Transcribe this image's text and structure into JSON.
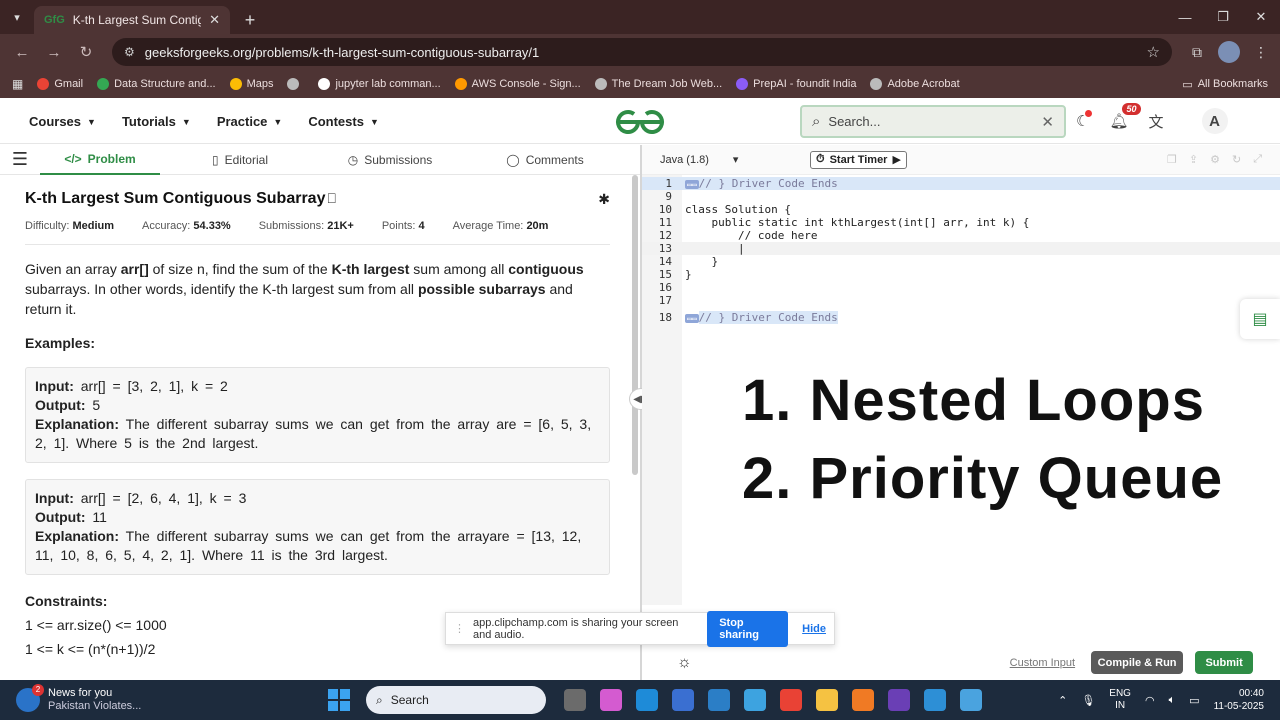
{
  "browser": {
    "tab_title": "K-th Largest Sum Contiguous S",
    "tab_favicon": "GfG",
    "url": "geeksforgeeks.org/problems/k-th-largest-sum-contiguous-subarray/1",
    "bookmarks": [
      {
        "label": "Gmail",
        "color": "#ea4335"
      },
      {
        "label": "Data Structure and...",
        "color": "#34a853"
      },
      {
        "label": "Maps",
        "color": "#fbbc05"
      },
      {
        "label": "",
        "color": "#bbbbbb"
      },
      {
        "label": "jupyter lab comman...",
        "color": "#ffffff"
      },
      {
        "label": "AWS Console - Sign...",
        "color": "#ff9900"
      },
      {
        "label": "The Dream Job Web...",
        "color": "#bbbbbb"
      },
      {
        "label": "PrepAI - foundit India",
        "color": "#8b5cf6"
      },
      {
        "label": "Adobe Acrobat",
        "color": "#bbbbbb"
      }
    ],
    "all_bookmarks": "All Bookmarks"
  },
  "header": {
    "nav": [
      "Courses",
      "Tutorials",
      "Practice",
      "Contests"
    ],
    "search_placeholder": "Search...",
    "notif_count": "50",
    "avatar": "A"
  },
  "subtabs": {
    "problem": "Problem",
    "editorial": "Editorial",
    "submissions": "Submissions",
    "comments": "Comments"
  },
  "problem": {
    "title": "K-th Largest Sum Contiguous Subarray",
    "meta": {
      "difficulty_label": "Difficulty:",
      "difficulty": "Medium",
      "accuracy_label": "Accuracy:",
      "accuracy": "54.33%",
      "submissions_label": "Submissions:",
      "submissions": "21K+",
      "points_label": "Points:",
      "points": "4",
      "avgtime_label": "Average Time:",
      "avgtime": "20m"
    },
    "desc": {
      "p1": "Given an array ",
      "b1": "arr[]",
      "p2": " of size n, find the sum of the ",
      "b2": "K-th largest",
      "p3": " sum among all ",
      "b3": "contiguous",
      "p4": " subarrays. In other words, identify the K-th largest sum from all ",
      "b4": "possible subarrays",
      "p5": " and return it."
    },
    "examples_heading": "Examples:",
    "examples": [
      {
        "input_label": "Input:",
        "input": " arr[] = [3, 2, 1], k = 2",
        "output_label": "Output:",
        "output": " 5",
        "expl_label": "Explanation:",
        "expl": " The different subarray sums we can get from the array are = [6, 5, 3, 2, 1]. Where 5 is the 2nd largest."
      },
      {
        "input_label": "Input:",
        "input": " arr[] = [2, 6, 4, 1], k = 3",
        "output_label": "Output:",
        "output": " 11",
        "expl_label": "Explanation:",
        "expl": " The different subarray sums we can get from the arrayare = [13, 12, 11, 10, 8, 6, 5, 4, 2, 1]. Where 11 is the 3rd largest."
      }
    ],
    "constraints_heading": "Constraints:",
    "constraints": [
      "1 <= arr.size() <= 1000",
      "1 <= k <= (n*(n+1))/2"
    ]
  },
  "editor": {
    "language": "Java (1.8)",
    "timer_label": "Start Timer",
    "lines": [
      {
        "n": "1",
        "code": "// } Driver Code Ends"
      },
      {
        "n": "9",
        "code": ""
      },
      {
        "n": "10",
        "code": "class Solution {"
      },
      {
        "n": "11",
        "code": "    public static int kthLargest(int[] arr, int k) {"
      },
      {
        "n": "12",
        "code": "        // code here"
      },
      {
        "n": "13",
        "code": "        |"
      },
      {
        "n": "14",
        "code": "    }"
      },
      {
        "n": "15",
        "code": "}"
      },
      {
        "n": "16",
        "code": ""
      },
      {
        "n": "17",
        "code": ""
      },
      {
        "n": "18",
        "code": "// } Driver Code Ends"
      }
    ],
    "overlay": [
      "1. Nested Loops",
      "2. Priority Queue"
    ],
    "custom_input": "Custom Input",
    "compile_run": "Compile & Run",
    "submit": "Submit"
  },
  "sharebar": {
    "message": "app.clipchamp.com is sharing your screen and audio.",
    "stop": "Stop sharing",
    "hide": "Hide"
  },
  "taskbar": {
    "news_title": "News for you",
    "news_sub": "Pakistan Violates...",
    "news_badge": "2",
    "search": "Search",
    "lang_top": "ENG",
    "lang_bottom": "IN",
    "time": "00:40",
    "date": "11-05-2025"
  }
}
